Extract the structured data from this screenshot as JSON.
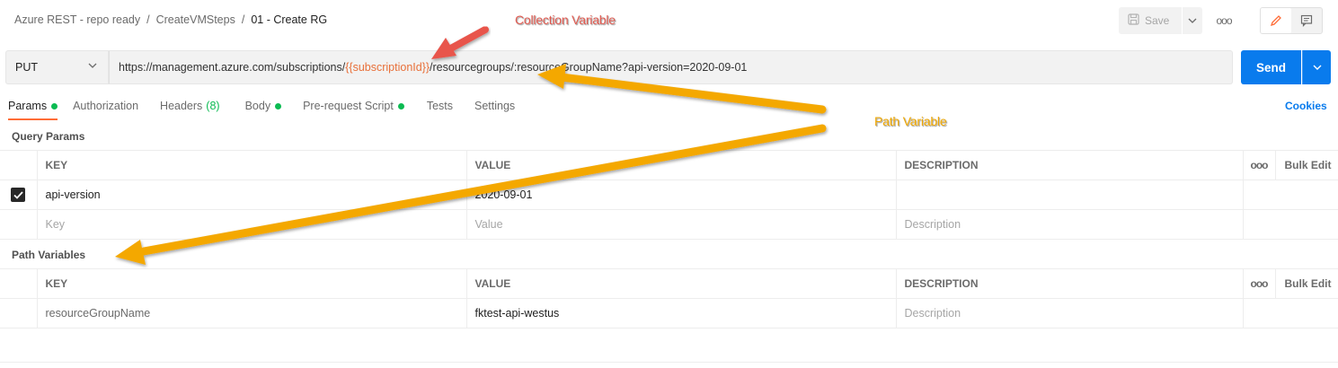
{
  "breadcrumb": {
    "collection": "Azure REST - repo ready",
    "folder": "CreateVMSteps",
    "request": "01 - Create RG",
    "separator": "/"
  },
  "toolbar": {
    "save_label": "Save",
    "more_label": "ooo"
  },
  "request": {
    "method": "PUT",
    "url_prefix": "https://management.azure.com/subscriptions/",
    "url_variable": "{{subscriptionId}}",
    "url_suffix": "/resourcegroups/:resourceGroupName?api-version=2020-09-01",
    "send_label": "Send"
  },
  "tabs": [
    {
      "label": "Params",
      "dot": true,
      "active": true
    },
    {
      "label": "Authorization"
    },
    {
      "label": "Headers",
      "count": "(8)"
    },
    {
      "label": "Body",
      "dot": true
    },
    {
      "label": "Pre-request Script",
      "dot": true
    },
    {
      "label": "Tests"
    },
    {
      "label": "Settings"
    }
  ],
  "cookies_label": "Cookies",
  "query_params": {
    "title": "Query Params",
    "headers": {
      "key": "KEY",
      "value": "VALUE",
      "description": "DESCRIPTION",
      "more": "ooo",
      "bulk_edit": "Bulk Edit"
    },
    "rows": [
      {
        "checked": true,
        "key": "api-version",
        "value": "2020-09-01",
        "description": ""
      }
    ],
    "placeholder": {
      "key": "Key",
      "value": "Value",
      "description": "Description"
    }
  },
  "path_variables": {
    "title": "Path Variables",
    "headers": {
      "key": "KEY",
      "value": "VALUE",
      "description": "DESCRIPTION",
      "more": "ooo",
      "bulk_edit": "Bulk Edit"
    },
    "rows": [
      {
        "key": "resourceGroupName",
        "value": "fktest-api-westus",
        "description_placeholder": "Description"
      }
    ]
  },
  "annotations": {
    "collection_variable": "Collection Variable",
    "path_variable": "Path Variable"
  },
  "colors": {
    "accent": "#ff6c37",
    "send": "#097bed",
    "variable": "#e8703a",
    "green_dot": "#0cbb52",
    "annotation_red": "#e05a50",
    "annotation_orange": "#f0a800"
  }
}
